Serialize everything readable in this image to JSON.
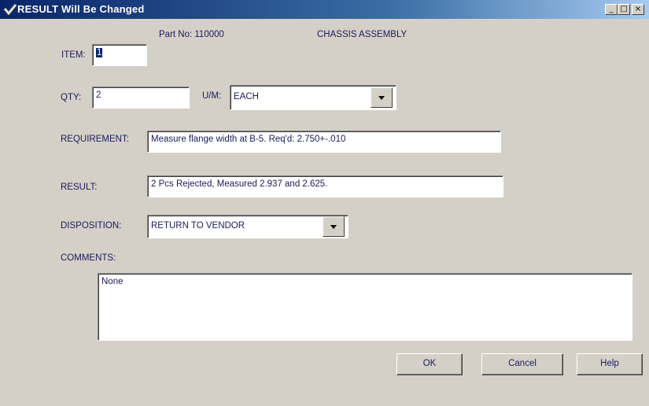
{
  "window": {
    "title": "RESULT Will Be Changed",
    "min_icon": "minimize-icon",
    "max_icon": "maximize-icon",
    "close_icon": "close-icon"
  },
  "header": {
    "part_no": "Part No: 110000",
    "description": "CHASSIS ASSEMBLY"
  },
  "form": {
    "item_label": "ITEM:",
    "item_value": "1",
    "qty_label": "QTY:",
    "qty_value": "2",
    "um_label": "U/M:",
    "um_value": "EACH",
    "requirement_label": "REQUIREMENT:",
    "requirement_value": "Measure flange width at B-5. Req'd: 2.750+-.010",
    "result_label": "RESULT:",
    "result_value": "2 Pcs Rejected, Measured 2.937 and 2.625.",
    "disposition_label": "DISPOSITION:",
    "disposition_value": "RETURN TO VENDOR",
    "comments_label": "COMMENTS:",
    "comments_value": "None"
  },
  "buttons": {
    "ok": "OK",
    "cancel": "Cancel",
    "help": "Help"
  },
  "colors": {
    "titlebar_start": "#0a246a",
    "titlebar_end": "#a6caf0",
    "dialog_bg": "#d4d0c8",
    "text": "#1c1c5a"
  }
}
